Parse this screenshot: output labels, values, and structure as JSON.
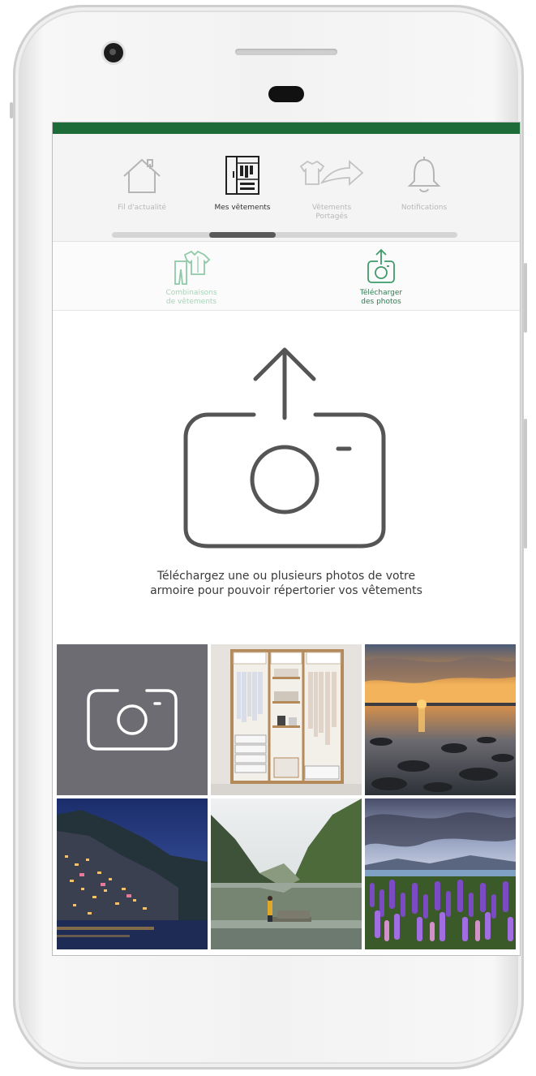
{
  "topnav": {
    "items": [
      {
        "label": "Fil d'actualité",
        "icon": "house-icon",
        "active": false
      },
      {
        "label": "Mes vêtements",
        "icon": "wardrobe-icon",
        "active": true
      },
      {
        "label": "Vêtements Portagés",
        "icon": "share-clothes-icon",
        "active": false
      },
      {
        "label": "Notifications",
        "icon": "bell-icon",
        "active": false
      }
    ]
  },
  "subtabs": {
    "items": [
      {
        "label_line1": "Combinaisons",
        "label_line2": "de vêtements",
        "icon": "outfit-icon"
      },
      {
        "label_line1": "Télécharger",
        "label_line2": "des photos",
        "icon": "camera-upload-icon"
      }
    ]
  },
  "hero": {
    "line1": "Téléchargez une ou plusieurs photos de votre",
    "line2": "armoire pour pouvoir répertorier vos vêtements"
  },
  "gallery": {
    "tiles": [
      {
        "kind": "camera",
        "icon": "camera-icon"
      },
      {
        "kind": "photo",
        "subject": "wardrobe"
      },
      {
        "kind": "photo",
        "subject": "sunset-lake"
      },
      {
        "kind": "photo",
        "subject": "coastal-village-night"
      },
      {
        "kind": "photo",
        "subject": "mountain-lake-person"
      },
      {
        "kind": "photo",
        "subject": "lupin-field"
      }
    ]
  },
  "colors": {
    "accent": "#1e6b3a",
    "subtab_green": "#3f9b6a",
    "inactive_text": "#b8b8b8"
  }
}
